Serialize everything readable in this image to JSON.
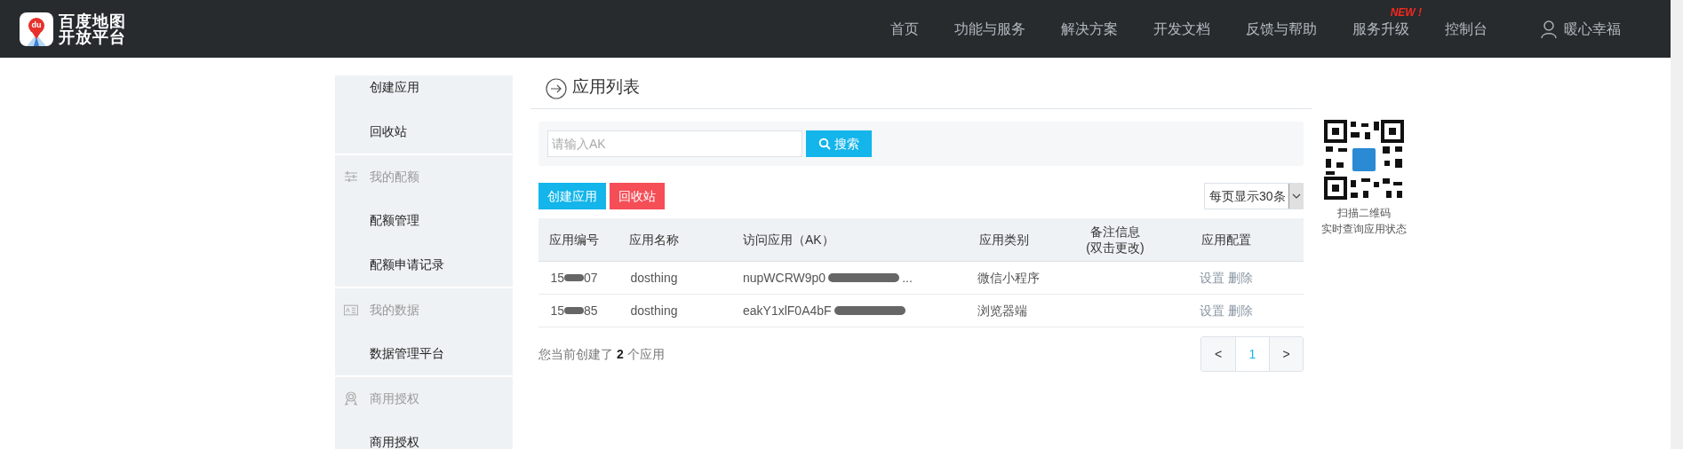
{
  "header": {
    "logo_line1": "百度地图",
    "logo_line2": "开放平台",
    "logo_badge": "du",
    "nav": [
      {
        "label": "首页"
      },
      {
        "label": "功能与服务"
      },
      {
        "label": "解决方案"
      },
      {
        "label": "开发文档"
      },
      {
        "label": "反馈与帮助"
      },
      {
        "label": "服务升级",
        "badge": "NEW !"
      },
      {
        "label": "控制台"
      }
    ],
    "user": "暖心幸福"
  },
  "sidebar": [
    {
      "kind": "item",
      "label": "创建应用"
    },
    {
      "kind": "item",
      "label": "回收站"
    },
    {
      "kind": "group",
      "label": "我的配额"
    },
    {
      "kind": "item",
      "label": "配额管理"
    },
    {
      "kind": "item",
      "label": "配额申请记录"
    },
    {
      "kind": "group",
      "label": "我的数据"
    },
    {
      "kind": "item",
      "label": "数据管理平台"
    },
    {
      "kind": "group",
      "label": "商用授权"
    },
    {
      "kind": "item",
      "label": "商用授权"
    }
  ],
  "main": {
    "title": "应用列表",
    "search": {
      "placeholder": "请输入AK",
      "button": "搜索"
    },
    "buttons": [
      {
        "label": "创建应用",
        "kind": "primary"
      },
      {
        "label": "回收站",
        "kind": "danger"
      }
    ],
    "page_size": "每页显示30条",
    "table": {
      "columns": [
        "应用编号",
        "应用名称",
        "访问应用（AK）",
        "应用类别",
        "备注信息\n(双击更改)",
        "应用配置"
      ],
      "rows": [
        {
          "id_start": "15",
          "id_end": "07",
          "name": "dosthing",
          "ak": "nupWCRW9p0",
          "ak_end": "...",
          "category": "微信小程序",
          "actions": [
            "设置",
            "删除"
          ]
        },
        {
          "id_start": "15",
          "id_end": "85",
          "name": "dosthing",
          "ak": "eakY1xlF0A4bF",
          "category": "浏览器端",
          "actions": [
            "设置",
            "删除"
          ]
        }
      ]
    },
    "summary": "您当前创建了 **2** 个应用",
    "pager": [
      "<",
      "1",
      ">"
    ]
  },
  "qr": {
    "caption_1": "扫描二维码",
    "caption_2": "实时查询应用状态"
  }
}
